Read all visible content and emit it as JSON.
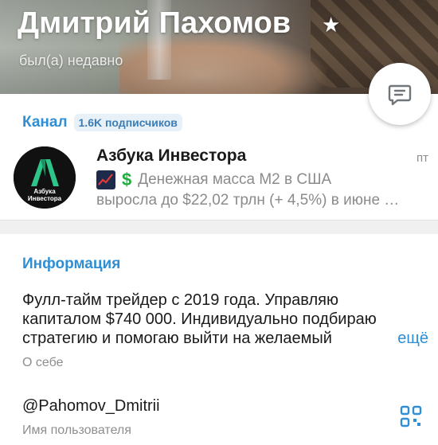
{
  "profile": {
    "name": "Дмитрий Пахомов",
    "status": "был(а) недавно",
    "star_icon": "star-icon"
  },
  "channel": {
    "section_label": "Канал",
    "subscribers": "1.6K подписчиков",
    "title": "Азбука Инвестора",
    "time": "пт",
    "avatar_text_line1": "Азбука",
    "avatar_text_line2": "Инвестора",
    "preview_line1": "Денежная масса М2 в США",
    "preview_line2": "выросла до $22,02 трлн (+ 4,5%) в июне …",
    "dollar_glyph": "$"
  },
  "info": {
    "section_title": "Информация",
    "bio_line1": "Фулл-тайм трейдер с 2019 года. Управляю",
    "bio_line2": "капиталом $740 000. Индивидуально подбираю",
    "bio_line3": "стратегию и помогаю выйти на желаемый",
    "bio_fade": "",
    "more_label": "ещё",
    "bio_caption": "О себе",
    "username": "@Pahomov_Dmitrii",
    "username_caption": "Имя пользователя"
  },
  "colors": {
    "accent": "#2f8ed4",
    "secondary_text": "#8e8e8e",
    "badge_bg": "#e9f1f8"
  }
}
